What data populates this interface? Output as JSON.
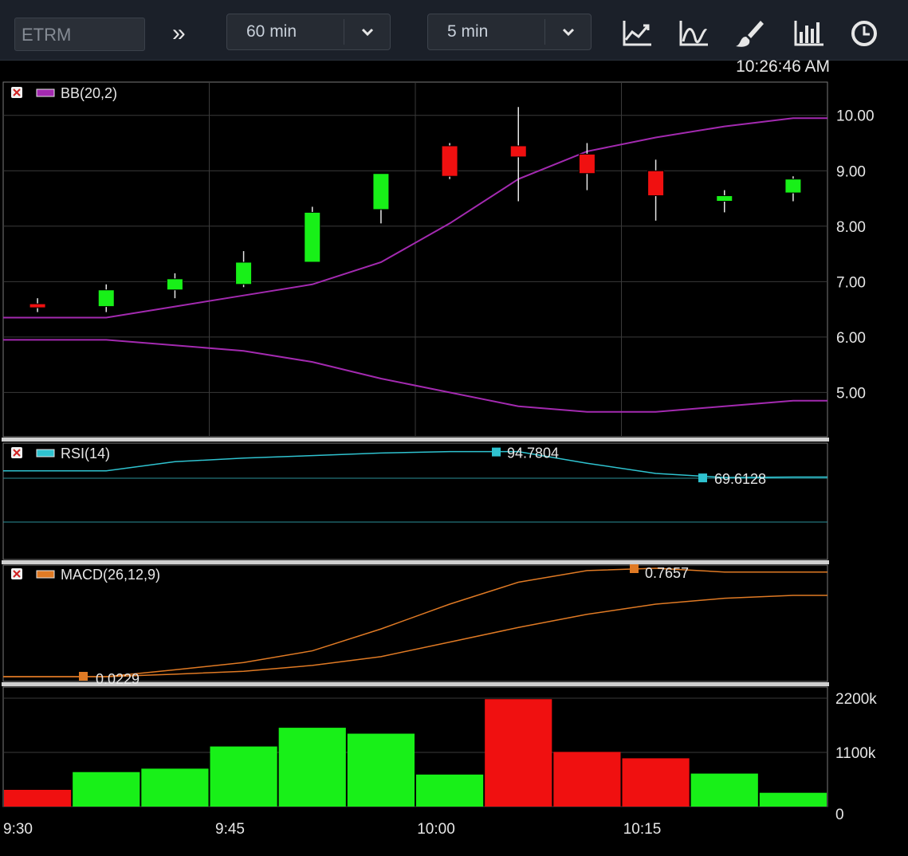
{
  "toolbar": {
    "symbol_placeholder": "ETRM",
    "range_value": "60 min",
    "interval_value": "5 min",
    "icons": [
      "chevrons-right-icon",
      "line-chart-icon",
      "indicator-chart-icon",
      "brush-icon",
      "volume-bars-icon",
      "clock-icon"
    ]
  },
  "clock": "10:26:46 AM",
  "legend": {
    "bb": "BB(20,2)",
    "rsi": "RSI(14)",
    "macd": "MACD(26,12,9)"
  },
  "value_labels": {
    "rsi_max": "94.7804",
    "rsi_last": "69.6128",
    "macd_max": "0.7657",
    "macd_min": "0.0229"
  },
  "colors": {
    "up": "#18f018",
    "down": "#f01010",
    "bb": "#a32ab0",
    "rsi": "#2fc3d0",
    "macd": "#e07a24",
    "panel_sep": "#cfcfcf"
  },
  "chart_data": [
    {
      "type": "candlestick",
      "legend": "BB(20,2)",
      "x": [
        "9:30",
        "9:35",
        "9:40",
        "9:45",
        "9:50",
        "9:55",
        "10:00",
        "10:05",
        "10:10",
        "10:15",
        "10:20",
        "10:25"
      ],
      "open": [
        6.6,
        6.55,
        6.85,
        6.95,
        7.35,
        8.3,
        9.45,
        9.45,
        9.3,
        9.0,
        8.45,
        8.6
      ],
      "high": [
        6.7,
        6.95,
        7.15,
        7.55,
        8.35,
        8.95,
        9.5,
        10.15,
        9.5,
        9.2,
        8.65,
        8.9
      ],
      "low": [
        6.45,
        6.45,
        6.7,
        6.9,
        7.35,
        8.05,
        8.85,
        8.45,
        8.65,
        8.1,
        8.25,
        8.45
      ],
      "close": [
        6.6,
        6.85,
        7.05,
        7.35,
        8.25,
        8.95,
        8.9,
        9.25,
        8.95,
        8.55,
        8.55,
        8.85
      ],
      "bb_upper": [
        6.35,
        6.35,
        6.55,
        6.75,
        6.95,
        7.35,
        8.05,
        8.85,
        9.35,
        9.6,
        9.8,
        9.95
      ],
      "bb_lower": [
        5.95,
        5.95,
        5.85,
        5.75,
        5.55,
        5.25,
        5.0,
        4.75,
        4.65,
        4.65,
        4.75,
        4.85
      ],
      "ylim": [
        4.2,
        10.6
      ],
      "yticks": [
        "5.00",
        "6.00",
        "7.00",
        "8.00",
        "9.00",
        "10.00"
      ]
    },
    {
      "type": "line",
      "legend": "RSI(14)",
      "x": [
        "9:30",
        "9:35",
        "9:40",
        "9:45",
        "9:50",
        "9:55",
        "10:00",
        "10:05",
        "10:10",
        "10:15",
        "10:20",
        "10:25"
      ],
      "values": [
        91.0,
        91.0,
        92.8,
        93.5,
        94.0,
        94.5,
        94.78,
        94.78,
        92.5,
        90.5,
        89.7,
        89.8
      ]
    },
    {
      "type": "line",
      "legend": "MACD(26,12,9)",
      "x": [
        "9:30",
        "9:35",
        "9:40",
        "9:45",
        "9:50",
        "9:55",
        "10:00",
        "10:05",
        "10:10",
        "10:15",
        "10:20",
        "10:25"
      ],
      "series": [
        {
          "values": [
            0.0229,
            0.0229,
            0.07,
            0.12,
            0.2,
            0.35,
            0.52,
            0.67,
            0.75,
            0.7657,
            0.74,
            0.74
          ]
        },
        {
          "values": [
            0.0229,
            0.0229,
            0.04,
            0.06,
            0.1,
            0.16,
            0.26,
            0.36,
            0.45,
            0.52,
            0.56,
            0.58
          ]
        }
      ]
    },
    {
      "type": "bar",
      "x": [
        "9:30",
        "9:35",
        "9:40",
        "9:45",
        "9:50",
        "9:55",
        "10:00",
        "10:05",
        "10:10",
        "10:15",
        "10:20",
        "10:25"
      ],
      "values": [
        340,
        700,
        770,
        1220,
        1600,
        1480,
        650,
        2180,
        1110,
        980,
        670,
        280
      ],
      "direction": [
        "down",
        "up",
        "up",
        "up",
        "up",
        "up",
        "up",
        "down",
        "down",
        "down",
        "up",
        "up"
      ],
      "ylim": [
        0,
        2200
      ],
      "yticks": [
        "0",
        "1100k",
        "2200k"
      ]
    }
  ],
  "x_axis": {
    "ticks": [
      "9:30",
      "9:45",
      "10:00",
      "10:15"
    ]
  }
}
